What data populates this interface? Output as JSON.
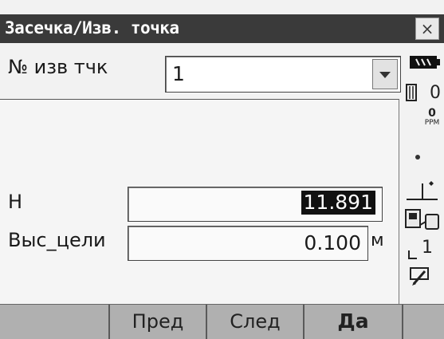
{
  "window": {
    "title": "Засечка/Изв. точка",
    "close_label": "×"
  },
  "point": {
    "label": "№ изв тчк",
    "value": "1"
  },
  "fields": {
    "h_label": "H",
    "h_value": "11.891",
    "target_label": "Выс_цели",
    "target_value": "0.100",
    "target_unit": "м"
  },
  "status": {
    "count_value": "0",
    "ppm_value": "0",
    "ppm_label": "PPM",
    "page_value": "1",
    "icons": [
      "battery-icon",
      "prism-icon",
      "ppm-icon",
      "dot-icon",
      "tilt-icon",
      "instrument-icon",
      "page-icon",
      "pencil-icon"
    ]
  },
  "softkeys": [
    "",
    "Пред",
    "След",
    "Да",
    ""
  ],
  "colors": {
    "titlebar": "#3a3a3a",
    "softkey_bar": "#b0b0b0",
    "selection": "#111111"
  }
}
